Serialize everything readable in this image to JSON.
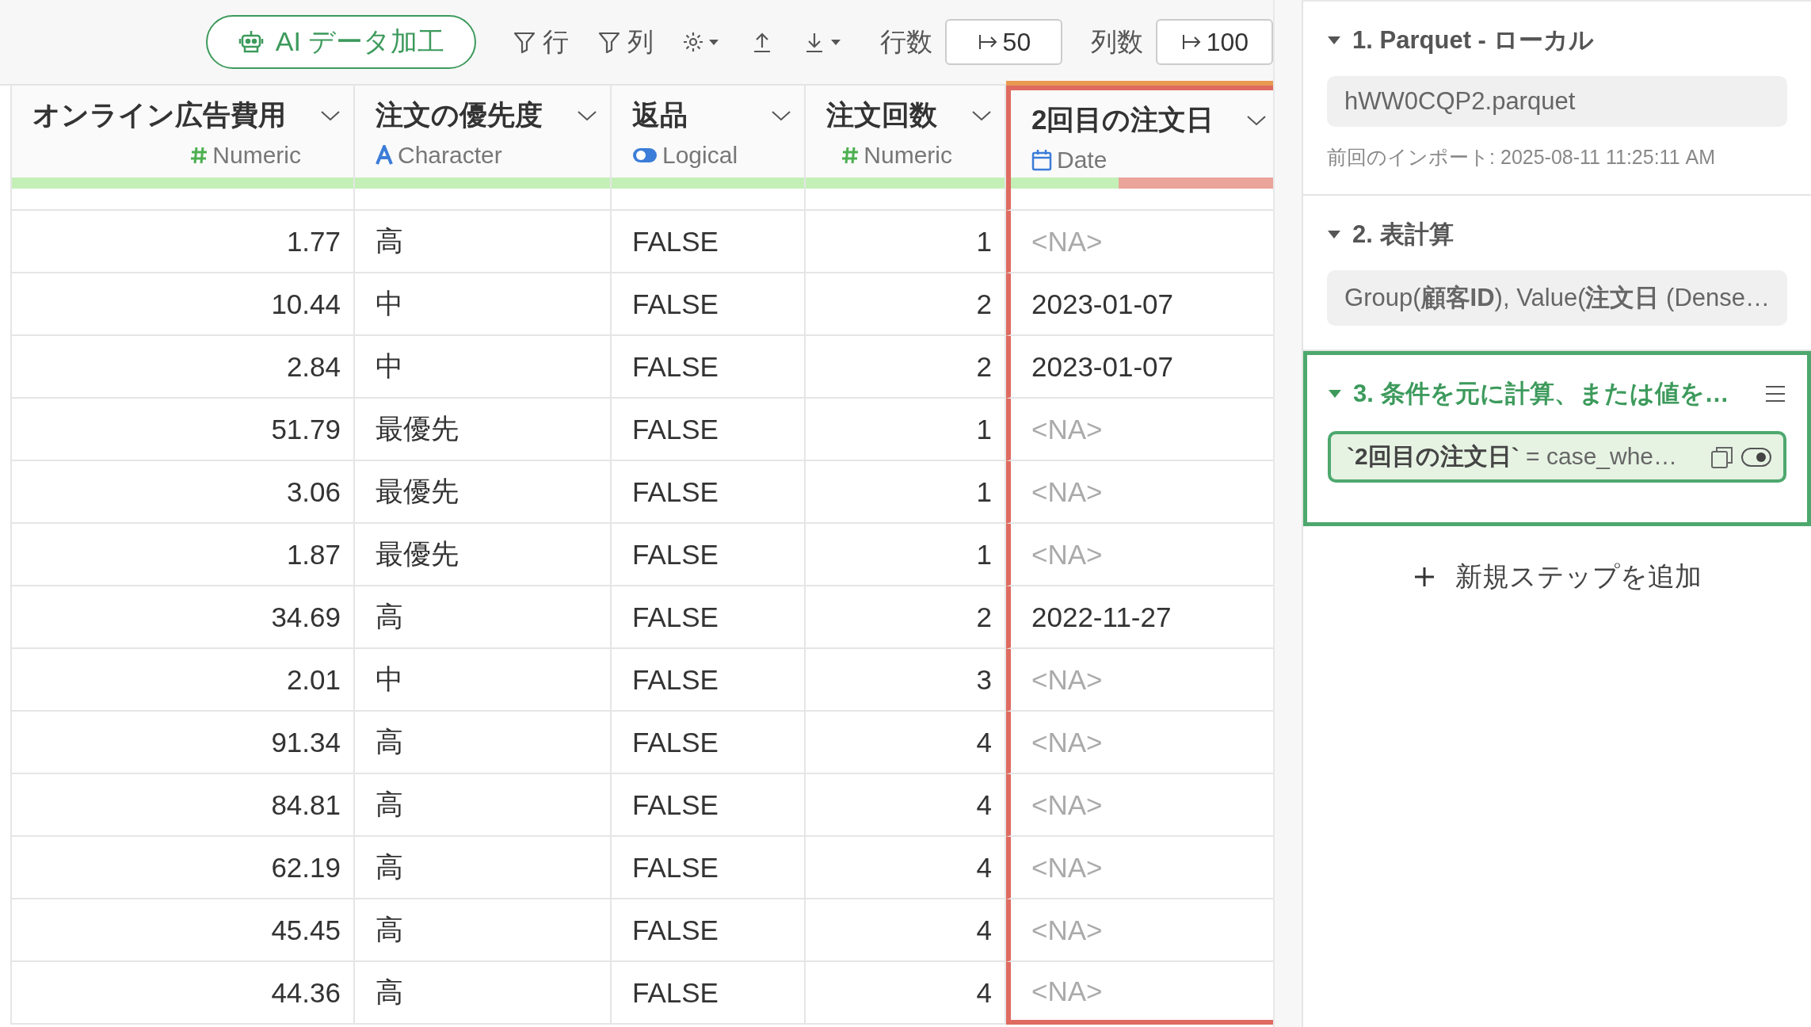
{
  "toolbar": {
    "ai_button": "AI データ加工",
    "row_filter": "行",
    "column_filter": "列",
    "row_count_label": "行数",
    "row_count": "50",
    "column_count_label": "列数",
    "column_count": "100"
  },
  "table": {
    "columns": [
      {
        "title": "オンライン広告費用",
        "type": "Numeric",
        "kind": "numeric",
        "level": 1,
        "highlighted": false
      },
      {
        "title": "注文の優先度",
        "type": "Character",
        "kind": "character",
        "level": 1,
        "highlighted": false
      },
      {
        "title": "返品",
        "type": "Logical",
        "kind": "logical",
        "level": 1,
        "highlighted": false
      },
      {
        "title": "注文回数",
        "type": "Numeric",
        "kind": "numeric",
        "level": 1,
        "highlighted": false
      },
      {
        "title": "2回目の注文日",
        "type": "Date",
        "kind": "date",
        "level": 0.4,
        "highlighted": true
      }
    ],
    "rows": [
      {
        "cells": [
          "1.77",
          "高",
          "FALSE",
          "1",
          "<NA>"
        ],
        "missing": true
      },
      {
        "cells": [
          "10.44",
          "中",
          "FALSE",
          "2",
          "2023-01-07"
        ],
        "missing": false
      },
      {
        "cells": [
          "2.84",
          "中",
          "FALSE",
          "2",
          "2023-01-07"
        ],
        "missing": false
      },
      {
        "cells": [
          "51.79",
          "最優先",
          "FALSE",
          "1",
          "<NA>"
        ],
        "missing": true
      },
      {
        "cells": [
          "3.06",
          "最優先",
          "FALSE",
          "1",
          "<NA>"
        ],
        "missing": true
      },
      {
        "cells": [
          "1.87",
          "最優先",
          "FALSE",
          "1",
          "<NA>"
        ],
        "missing": true
      },
      {
        "cells": [
          "34.69",
          "高",
          "FALSE",
          "2",
          "2022-11-27"
        ],
        "missing": false
      },
      {
        "cells": [
          "2.01",
          "中",
          "FALSE",
          "3",
          "<NA>"
        ],
        "missing": true
      },
      {
        "cells": [
          "91.34",
          "高",
          "FALSE",
          "4",
          "<NA>"
        ],
        "missing": true
      },
      {
        "cells": [
          "84.81",
          "高",
          "FALSE",
          "4",
          "<NA>"
        ],
        "missing": true
      },
      {
        "cells": [
          "62.19",
          "高",
          "FALSE",
          "4",
          "<NA>"
        ],
        "missing": true
      },
      {
        "cells": [
          "45.45",
          "高",
          "FALSE",
          "4",
          "<NA>"
        ],
        "missing": true
      },
      {
        "cells": [
          "44.36",
          "高",
          "FALSE",
          "4",
          "<NA>"
        ],
        "missing": true
      }
    ]
  },
  "steps": [
    {
      "title": "1. Parquet - ローカル",
      "kind": "source",
      "selected": false,
      "expanded": true,
      "detail": "hWW0CQP2.parquet",
      "note": "前回のインポート: 2025-08-11 11:25:11 AM"
    },
    {
      "title": "2. 表計算",
      "kind": "plain",
      "selected": false,
      "expanded": true,
      "detail": "Group(**顧客ID**), Value(**注文日** (Dense…"
    },
    {
      "title": "3. 条件を元に計算、または値を…",
      "kind": "command",
      "selected": true,
      "expanded": true,
      "detail": "**`2回目の注文日`** = case_whe…",
      "visible": true
    }
  ],
  "add_step": "新規ステップを追加"
}
